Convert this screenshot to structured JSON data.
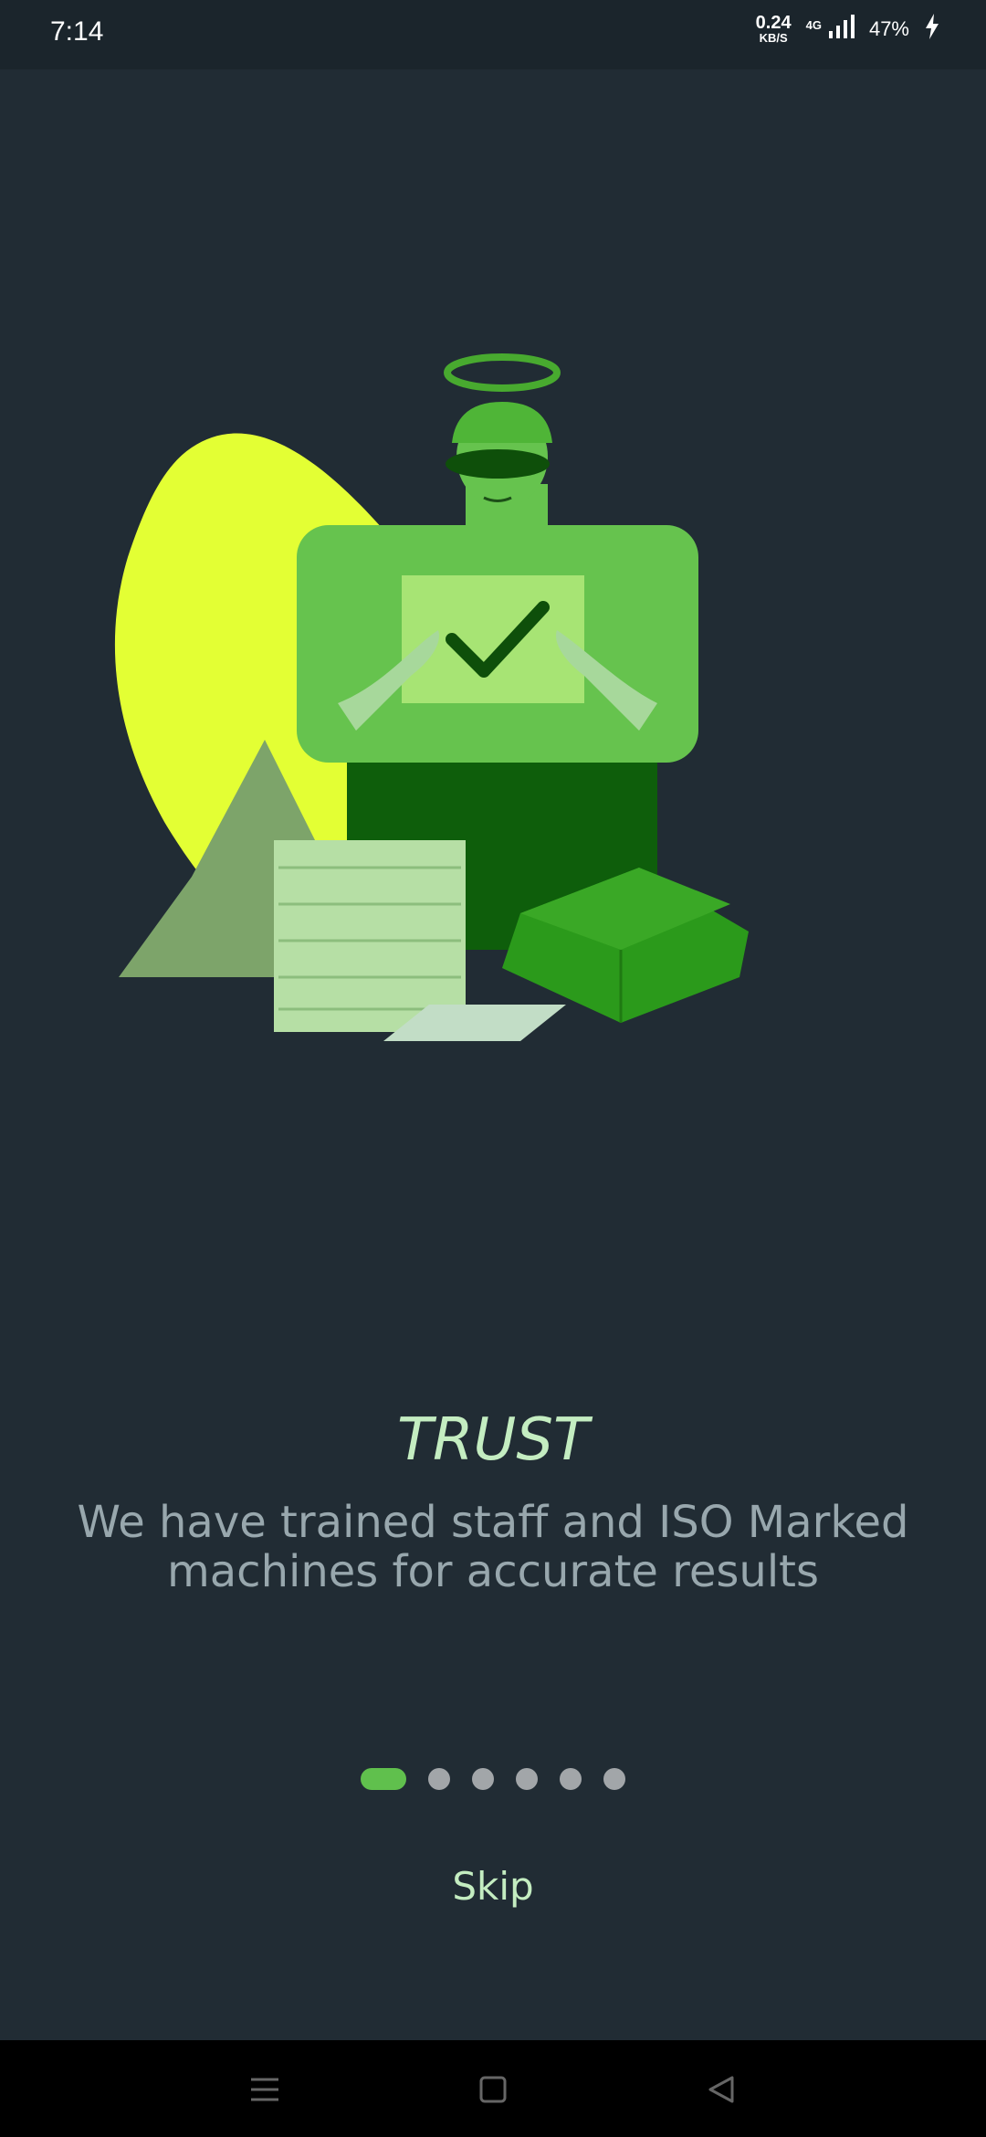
{
  "status_bar": {
    "time": "7:14",
    "net_speed_value": "0.24",
    "net_speed_unit": "KB/S",
    "network_type": "4G",
    "battery_percent": "47%",
    "icons": [
      "signal-icon",
      "charging-icon"
    ]
  },
  "onboarding": {
    "title": "TRUST",
    "description": "We have trained staff and ISO Marked machines for accurate results",
    "page_count": 6,
    "active_page": 0,
    "skip_label": "Skip"
  },
  "colors": {
    "background": "#212c34",
    "title": "#c4edc1",
    "description": "#98a7ad",
    "accent": "#60c04d",
    "dot_inactive": "#a2a6a9"
  },
  "nav_bar": {
    "icons": [
      "menu-icon",
      "home-icon",
      "back-icon"
    ]
  }
}
